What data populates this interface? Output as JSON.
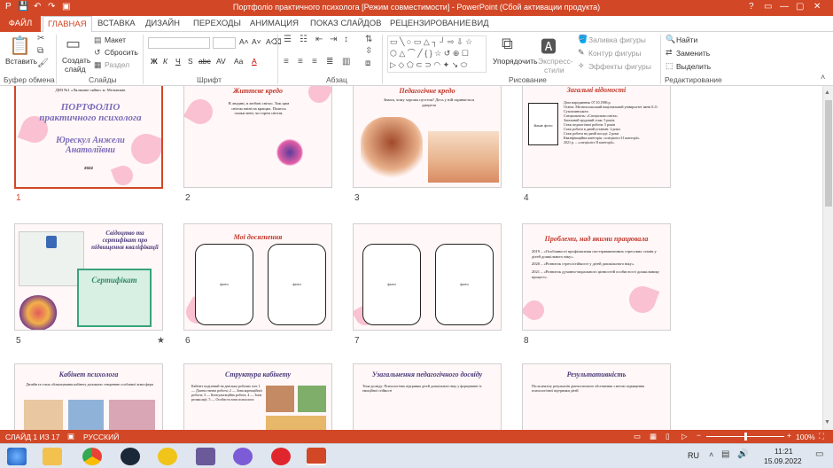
{
  "window": {
    "title": "Портфоліо практичного психолога [Режим совместимости]  -  PowerPoint (Сбой активации продукта)",
    "qa_icons": [
      "save-icon",
      "undo-icon",
      "redo-icon",
      "present-icon"
    ],
    "controls": [
      "?",
      "▭",
      "—",
      "▢",
      "✕"
    ]
  },
  "tabs": {
    "file": "ФАЙЛ",
    "items": [
      "ГЛАВНАЯ",
      "ВСТАВКА",
      "ДИЗАЙН",
      "ПЕРЕХОДЫ",
      "АНИМАЦИЯ",
      "ПОКАЗ СЛАЙДОВ",
      "РЕЦЕНЗИРОВАНИЕ",
      "ВИД"
    ]
  },
  "ribbon": {
    "clipboard": {
      "paste": "Вставить",
      "label": "Буфер обмена"
    },
    "slides": {
      "create": "Создать",
      "create2": "слайд",
      "layout": "Макет",
      "reset": "Сбросить",
      "section": "Раздел",
      "label": "Слайды"
    },
    "font": {
      "label": "Шрифт",
      "buttons": [
        "Ж",
        "К",
        "Ч",
        "S",
        "abc",
        "AV",
        "Aa",
        "A"
      ]
    },
    "paragraph": {
      "label": "Абзац"
    },
    "drawing": {
      "arrange": "Упорядочить",
      "styles": "Экспресс-",
      "styles2": "стили",
      "fill": "Заливка фигуры",
      "outline": "Контур фигуры",
      "effects": "Эффекты фигуры",
      "label": "Рисование"
    },
    "editing": {
      "find": "Найти",
      "replace": "Заменить",
      "select": "Выделить",
      "label": "Редактирование"
    }
  },
  "slides": [
    {
      "n": "1",
      "dns": "ДНЗ №1 «Ляльчине сяйво» м. Мельників",
      "title": "ПОРТФОЛІО практичного психолога",
      "name": "Юрескул Анжели Анатоліївни",
      "year": "2022"
    },
    {
      "n": "2",
      "title": "Життєве кредо",
      "text": "В людині, в любові світло. Тож цим світом зміні на кращих. Полюсь скажи мені, чи горем світом."
    },
    {
      "n": "3",
      "title": "Педагогічне кредо",
      "text": "Знаєш, чому хороша пустеля? Десь у ній скривається джерела"
    },
    {
      "n": "4",
      "title": "Загальні відомості",
      "photo": "Ваше фото",
      "lines": [
        "Дата народження: 07.10.1986 р.",
        "Освіта: Мелітопольський національний університет імені Б.О. Сухомлинського",
        "Спеціальність: «Спеціальна освіта»",
        "Загальний трудовий стаж: 5 років",
        "Стаж педагогічної роботи: 5 років",
        "Стаж роботи в даній установі: 2 роки",
        "Стаж роботи на даній посаді: 2 роки",
        "Кваліфікаційна категорія: «спеціаліст II категорії»",
        "2021 р. – «спеціаліст II категорії»."
      ]
    },
    {
      "n": "5",
      "title": "Свідоцтво та сертифікат про підвищення кваліфікації",
      "cert": "Сертифікат",
      "star": "★"
    },
    {
      "n": "6",
      "title": "Мої досягнення",
      "photo1": "фото",
      "photo2": "фото"
    },
    {
      "n": "7",
      "photo1": "фото",
      "photo2": "фото"
    },
    {
      "n": "8",
      "title": "Проблеми, над якими працювала",
      "lines": [
        "2019 – «Особливості профілактики посттравматичних стресових станів у дітей дошкільного віку».",
        "2020 – «Розвиток стресостійкості у дітей дошкільного віку».",
        "2021 – «Розвиток духовно-морального цінностей особистості дошкільнику процесі»."
      ]
    },
    {
      "n": "9",
      "title": "Кабінет психолога",
      "text": "Дизайн та стиль облаштування кабінету допомагає створенню особливої атмосфери"
    },
    {
      "n": "10",
      "title": "Структура кабінету",
      "text": "Кабінет поділений на декілька робочих зон: 1 — Діагностична робота; 2 — Зона корекційної роботи; 3 — Консультаційна робота; 4 — Зона релаксації; 5 — Особиста зона психолога"
    },
    {
      "n": "11",
      "title": "Узагальнення педагогічного досвіду",
      "text": "Тема досвіду: Психологічна підтримка дітей дошкільного віку у формуванні їх емоційної стійкості"
    },
    {
      "n": "12",
      "title": "Результативність",
      "text": "Після аналізу результатів діагностичного обстеження з метою підвищення психологічної підтримки дітей"
    }
  ],
  "status": {
    "slide": "СЛАЙД 1 ИЗ 17",
    "lang": "РУССКИЙ",
    "zoom": "100%",
    "zoom_value": 1.0
  },
  "taskbar": {
    "lang": "RU",
    "time": "11:21",
    "date": "15.09.2022"
  },
  "colors": {
    "accent": "#d24726",
    "pink": "#f6a9c0",
    "title_red": "#c0392b"
  }
}
